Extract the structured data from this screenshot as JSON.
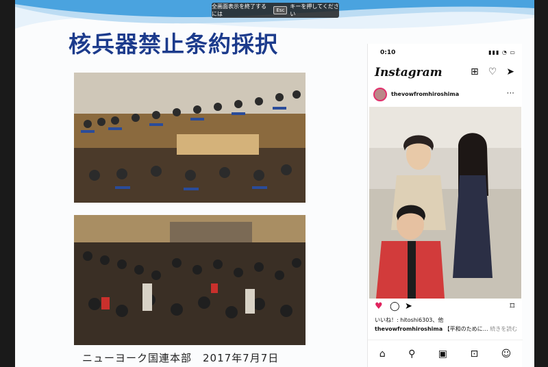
{
  "banner": {
    "text_before": "全画面表示を終了するには",
    "key": "Esc",
    "text_after": "キーを押してください"
  },
  "slide": {
    "title": "核兵器禁止条約採択",
    "caption": "ニューヨーク国連本部　2017年7月7日"
  },
  "phone": {
    "time": "0:10",
    "status_icons": "▮▮▮ ◔ ▭",
    "app_name": "Instagram",
    "username": "thevowfromhiroshima",
    "likes": "いいね！: hitoshi6303、他",
    "caption_user": "thevowfromhiroshima",
    "caption_text": "【平和のために…",
    "caption_more": "続きを読む"
  },
  "colors": {
    "title": "#1c3b8c",
    "heart": "#e0245e",
    "wave": "#4aa3df"
  }
}
